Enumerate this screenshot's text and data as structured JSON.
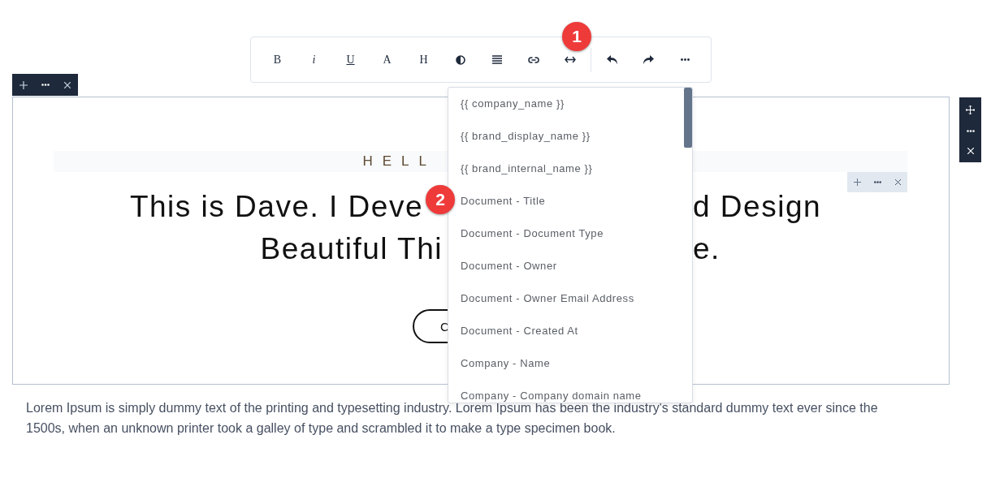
{
  "toolbar": {
    "groups": [
      [
        {
          "kind": "letter",
          "label": "B"
        },
        {
          "kind": "italic",
          "label": "i"
        },
        {
          "kind": "underline",
          "label": "U"
        },
        {
          "kind": "letter",
          "label": "A"
        },
        {
          "kind": "letter",
          "label": "H"
        },
        {
          "kind": "contrast"
        },
        {
          "kind": "align"
        },
        {
          "kind": "link"
        },
        {
          "kind": "code"
        }
      ],
      [
        {
          "kind": "undo"
        },
        {
          "kind": "redo"
        },
        {
          "kind": "more"
        }
      ]
    ]
  },
  "hero": {
    "eyebrow": "HELL",
    "heading_lines": [
      {
        "left": "This is Dave. I Deve",
        "right": "d Design"
      },
      {
        "left": "Beautiful Thi",
        "right": "e."
      }
    ],
    "button": "C"
  },
  "paragraph": "Lorem Ipsum is simply dummy text of the printing and typesetting industry. Lorem Ipsum has been the industry's standard dummy text ever since the 1500s, when an unknown printer took a galley of type and scrambled it to make a type specimen book.",
  "dropdown": {
    "items": [
      "{{ company_name }}",
      "{{ brand_display_name }}",
      "{{ brand_internal_name }}",
      "Document - Title",
      "Document - Document Type",
      "Document - Owner",
      "Document - Owner Email Address",
      "Document - Created At",
      "Company - Name",
      "Company - Company domain name"
    ]
  },
  "callouts": [
    {
      "label": "1"
    },
    {
      "label": "2"
    }
  ]
}
